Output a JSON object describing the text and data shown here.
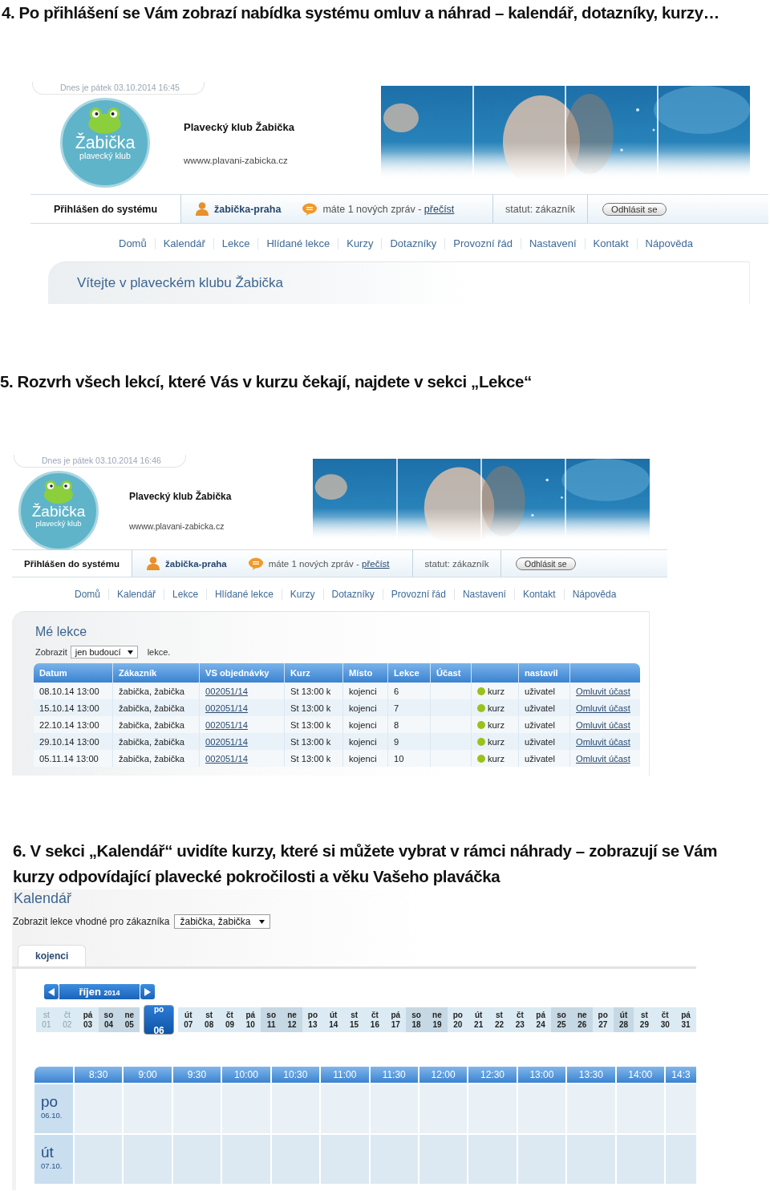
{
  "sections": [
    {
      "heading": "4. Po přihlášení se Vám zobrazí nabídka systému omluv a náhrad – kalendář, dotazníky, kurzy…",
      "screen": {
        "kind": "home",
        "header": {
          "date": "Dnes je pátek 03.10.2014 16:45",
          "logo_title": "Žabička",
          "logo_subtitle": "plavecký klub",
          "club_name": "Plavecký klub Žabička",
          "url": "wwww.plavani-zabicka.cz",
          "login_status": "Přihlášen do systému",
          "username": "žabička-praha",
          "message": "máte 1 nových zpráv -",
          "read_link": "přečíst",
          "status": "statut: zákazník",
          "logout": "Odhlásit se",
          "nav": [
            "Domů",
            "Kalendář",
            "Lekce",
            "Hlídané lekce",
            "Kurzy",
            "Dotazníky",
            "Provozní řád",
            "Nastavení",
            "Kontakt",
            "Nápověda"
          ]
        },
        "welcome": "Vítejte v plaveckém klubu Žabička"
      }
    },
    {
      "heading": "5. Rozvrh všech lekcí, které Vás v kurzu čekají, najdete v sekci „Lekce“",
      "screen": {
        "kind": "lessons",
        "header": {
          "date": "Dnes je pátek 03.10.2014 16:46",
          "logo_title": "Žabička",
          "logo_subtitle": "plavecký klub",
          "club_name": "Plavecký klub Žabička",
          "url": "wwww.plavani-zabicka.cz",
          "login_status": "Přihlášen do systému",
          "username": "žabička-praha",
          "message": "máte 1 nových zpráv -",
          "read_link": "přečíst",
          "status": "statut: zákazník",
          "logout": "Odhlásit se",
          "nav": [
            "Domů",
            "Kalendář",
            "Lekce",
            "Hlídané lekce",
            "Kurzy",
            "Dotazníky",
            "Provozní řád",
            "Nastavení",
            "Kontakt",
            "Nápověda"
          ]
        },
        "lessons": {
          "title": "Mé lekce",
          "filter_label": "Zobrazit",
          "filter_value": "jen budoucí",
          "filter_suffix": "lekce.",
          "columns": [
            {
              "label": "Datum",
              "kind": "text"
            },
            {
              "label": "Zákazník",
              "kind": "text"
            },
            {
              "label": "VS objednávky",
              "kind": "link"
            },
            {
              "label": "Kurz",
              "kind": "text"
            },
            {
              "label": "Místo",
              "kind": "text"
            },
            {
              "label": "Lekce",
              "kind": "text"
            },
            {
              "label": "Účast",
              "kind": "text"
            },
            {
              "kind": "status"
            },
            {
              "label": "nastavil",
              "kind": "text"
            },
            {
              "kind": "link"
            }
          ],
          "rows": [
            [
              "08.10.14 13:00",
              "žabička, žabička",
              "002051/14",
              "St 13:00 k",
              "kojenci",
              "6",
              null,
              "kurz",
              "uživatel",
              "Omluvit účast"
            ],
            [
              "15.10.14 13:00",
              "žabička, žabička",
              "002051/14",
              "St 13:00 k",
              "kojenci",
              "7",
              null,
              "kurz",
              "uživatel",
              "Omluvit účast"
            ],
            [
              "22.10.14 13:00",
              "žabička, žabička",
              "002051/14",
              "St 13:00 k",
              "kojenci",
              "8",
              null,
              "kurz",
              "uživatel",
              "Omluvit účast"
            ],
            [
              "29.10.14 13:00",
              "žabička, žabička",
              "002051/14",
              "St 13:00 k",
              "kojenci",
              "9",
              null,
              "kurz",
              "uživatel",
              "Omluvit účast"
            ],
            [
              "05.11.14 13:00",
              "žabička, žabička",
              "002051/14",
              "St 13:00 k",
              "kojenci",
              "10",
              null,
              "kurz",
              "uživatel",
              "Omluvit účast"
            ]
          ]
        }
      }
    },
    {
      "heading": "6. V sekci „Kalendář“ uvidíte kurzy, které si můžete vybrat v rámci náhrady – zobrazují se Vám kurzy odpovídající plavecké pokročilosti a věku Vašeho plaváčka",
      "screen": {
        "kind": "calendar",
        "calendar": {
          "title": "Kalendář",
          "filter_label": "Zobrazit lekce vhodné pro zákazníka",
          "filter_value": "žabička, žabička",
          "tabs": [
            {
              "label": "kojenci",
              "selected": true
            }
          ],
          "month": "říjen",
          "year": "2014",
          "days": [
            {
              "dow": "st",
              "day": "01",
              "shaded": false,
              "disabled": true,
              "selected": false
            },
            {
              "dow": "čt",
              "day": "02",
              "shaded": false,
              "disabled": true,
              "selected": false
            },
            {
              "dow": "pá",
              "day": "03",
              "shaded": false,
              "disabled": false,
              "selected": false
            },
            {
              "dow": "so",
              "day": "04",
              "shaded": true,
              "disabled": false,
              "selected": false
            },
            {
              "dow": "ne",
              "day": "05",
              "shaded": true,
              "disabled": false,
              "selected": false
            },
            {
              "dow": "po",
              "day": "06",
              "shaded": false,
              "disabled": false,
              "selected": true
            },
            {
              "dow": "út",
              "day": "07",
              "shaded": false,
              "disabled": false,
              "selected": false
            },
            {
              "dow": "st",
              "day": "08",
              "shaded": false,
              "disabled": false,
              "selected": false
            },
            {
              "dow": "čt",
              "day": "09",
              "shaded": false,
              "disabled": false,
              "selected": false
            },
            {
              "dow": "pá",
              "day": "10",
              "shaded": false,
              "disabled": false,
              "selected": false
            },
            {
              "dow": "so",
              "day": "11",
              "shaded": true,
              "disabled": false,
              "selected": false
            },
            {
              "dow": "ne",
              "day": "12",
              "shaded": true,
              "disabled": false,
              "selected": false
            },
            {
              "dow": "po",
              "day": "13",
              "shaded": false,
              "disabled": false,
              "selected": false
            },
            {
              "dow": "út",
              "day": "14",
              "shaded": false,
              "disabled": false,
              "selected": false
            },
            {
              "dow": "st",
              "day": "15",
              "shaded": false,
              "disabled": false,
              "selected": false
            },
            {
              "dow": "čt",
              "day": "16",
              "shaded": false,
              "disabled": false,
              "selected": false
            },
            {
              "dow": "pá",
              "day": "17",
              "shaded": false,
              "disabled": false,
              "selected": false
            },
            {
              "dow": "so",
              "day": "18",
              "shaded": true,
              "disabled": false,
              "selected": false
            },
            {
              "dow": "ne",
              "day": "19",
              "shaded": true,
              "disabled": false,
              "selected": false
            },
            {
              "dow": "po",
              "day": "20",
              "shaded": false,
              "disabled": false,
              "selected": false
            },
            {
              "dow": "út",
              "day": "21",
              "shaded": false,
              "disabled": false,
              "selected": false
            },
            {
              "dow": "st",
              "day": "22",
              "shaded": false,
              "disabled": false,
              "selected": false
            },
            {
              "dow": "čt",
              "day": "23",
              "shaded": false,
              "disabled": false,
              "selected": false
            },
            {
              "dow": "pá",
              "day": "24",
              "shaded": false,
              "disabled": false,
              "selected": false
            },
            {
              "dow": "so",
              "day": "25",
              "shaded": true,
              "disabled": false,
              "selected": false
            },
            {
              "dow": "ne",
              "day": "26",
              "shaded": true,
              "disabled": false,
              "selected": false
            },
            {
              "dow": "po",
              "day": "27",
              "shaded": false,
              "disabled": false,
              "selected": false
            },
            {
              "dow": "út",
              "day": "28",
              "shaded": true,
              "disabled": false,
              "selected": false
            },
            {
              "dow": "st",
              "day": "29",
              "shaded": false,
              "disabled": false,
              "selected": false
            },
            {
              "dow": "čt",
              "day": "30",
              "shaded": false,
              "disabled": false,
              "selected": false
            },
            {
              "dow": "pá",
              "day": "31",
              "shaded": false,
              "disabled": false,
              "selected": false
            }
          ],
          "times": [
            "8:30",
            "9:00",
            "9:30",
            "10:00",
            "10:30",
            "11:00",
            "11:30",
            "12:00",
            "12:30",
            "13:00",
            "13:30",
            "14:00",
            "14:3"
          ],
          "rows": [
            {
              "dow": "po",
              "date": "06.10."
            },
            {
              "dow": "út",
              "date": "07.10."
            }
          ]
        }
      }
    }
  ]
}
